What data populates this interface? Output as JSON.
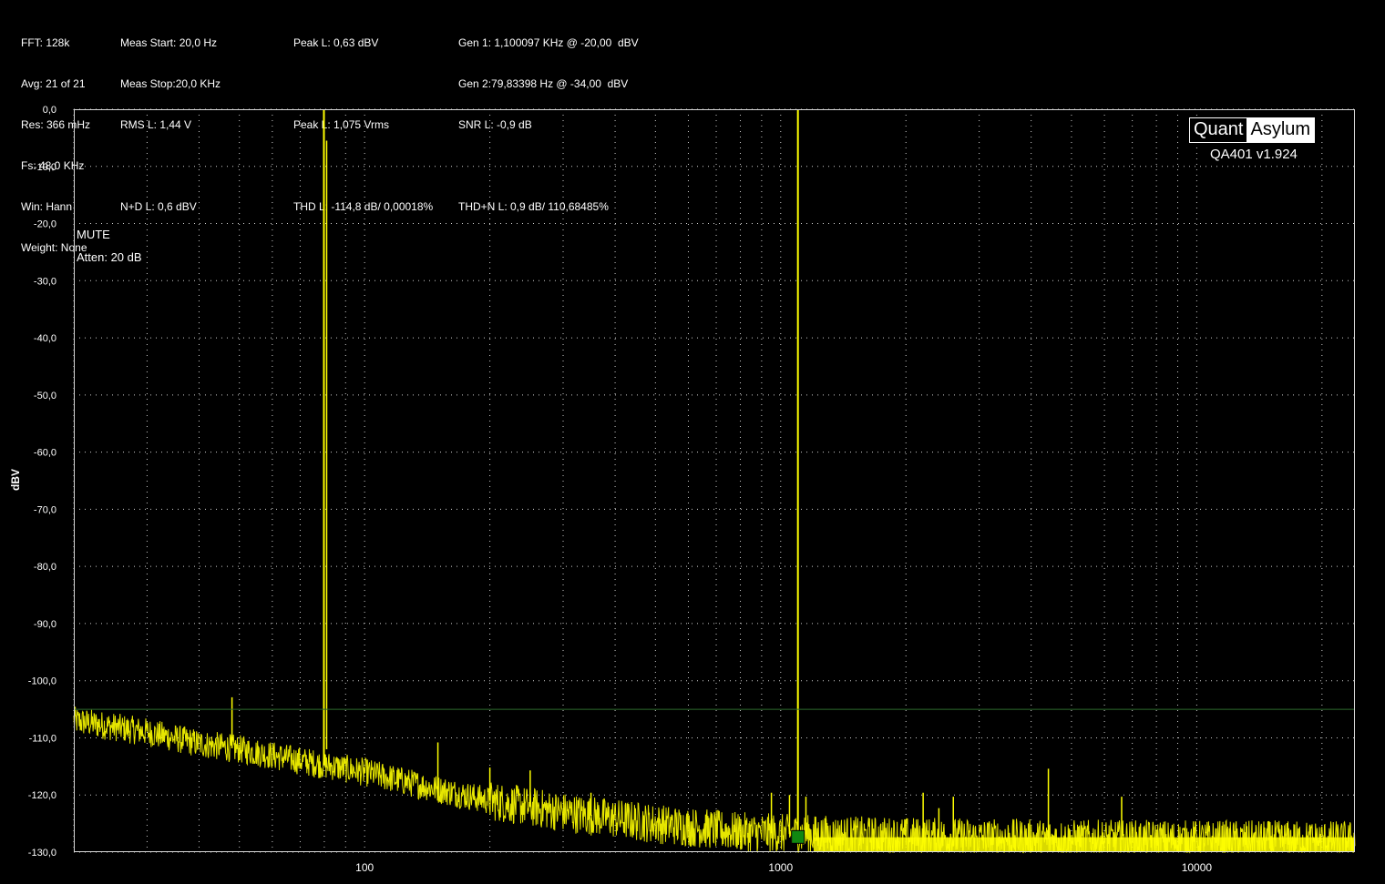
{
  "info": {
    "col1": [
      "FFT: 128k",
      "Avg: 21 of 21",
      "Res: 366 mHz",
      "Fs: 48,0 KHz",
      "Win: Hann",
      "Weight: None"
    ],
    "col2": [
      "Meas Start: 20,0 Hz",
      "Meas Stop:20,0 KHz",
      "RMS L: 1,44 V",
      "",
      "N+D L: 0,6 dBV"
    ],
    "col3": [
      "Peak L: 0,63 dBV",
      "",
      "Peak L: 1,075 Vrms",
      "",
      "THD L: -114,8 dB/ 0,00018%"
    ],
    "col4": [
      "Gen 1: 1,100097 KHz @ -20,00  dBV",
      "Gen 2:79,83398 Hz @ -34,00  dBV",
      "SNR L: -0,9 dB",
      "",
      "THD+N L: 0,9 dB/ 110,68485%"
    ]
  },
  "logo": {
    "left": "Quant",
    "right": "Asylum",
    "version": "QA401 v1.924"
  },
  "overlay": {
    "mute": "MUTE",
    "atten": "Atten: 20 dB"
  },
  "colors": {
    "trace": "#ffff00",
    "grid": "#cfcfcf",
    "marker": "#118811",
    "ref_line": "#2e6b2e"
  },
  "chart_data": {
    "type": "line",
    "xlabel": "",
    "ylabel": "dBV",
    "x_scale": "log",
    "xlim": [
      20,
      24000
    ],
    "ylim": [
      -130,
      0
    ],
    "x_ticks": [
      100,
      1000,
      10000
    ],
    "x_tick_labels": [
      "100",
      "1000",
      "10000"
    ],
    "y_ticks": [
      0,
      -10,
      -20,
      -30,
      -40,
      -50,
      -60,
      -70,
      -80,
      -90,
      -100,
      -110,
      -120,
      -130
    ],
    "y_tick_labels": [
      "0,0",
      "-10,0",
      "-20,0",
      "-30,0",
      "-40,0",
      "-50,0",
      "-60,0",
      "-70,0",
      "-80,0",
      "-90,0",
      "-100,0",
      "-110,0",
      "-120,0",
      "-130,0"
    ],
    "grid": true,
    "reference_line_dBV": -105,
    "marker_hz": 1100,
    "peaks": [
      {
        "hz": 79.83,
        "dbv": 0
      },
      {
        "hz": 1100.1,
        "dbv": 0
      },
      {
        "hz": 48,
        "dbv": -102.9
      },
      {
        "hz": 150,
        "dbv": -110.8
      },
      {
        "hz": 200,
        "dbv": -115.2
      },
      {
        "hz": 250,
        "dbv": -115.7
      },
      {
        "hz": 350,
        "dbv": -119.6
      },
      {
        "hz": 950,
        "dbv": -119.6
      },
      {
        "hz": 1050,
        "dbv": -120.0
      },
      {
        "hz": 1150,
        "dbv": -120.3
      },
      {
        "hz": 2200,
        "dbv": -119.6
      },
      {
        "hz": 2400,
        "dbv": -122.3
      },
      {
        "hz": 2600,
        "dbv": -120.3
      },
      {
        "hz": 4400,
        "dbv": -115.4
      },
      {
        "hz": 6600,
        "dbv": -120.3
      }
    ],
    "noise_floor": [
      {
        "hz": 20,
        "dbv": -107
      },
      {
        "hz": 30,
        "dbv": -109
      },
      {
        "hz": 40,
        "dbv": -111
      },
      {
        "hz": 50,
        "dbv": -112
      },
      {
        "hz": 70,
        "dbv": -114
      },
      {
        "hz": 100,
        "dbv": -116
      },
      {
        "hz": 150,
        "dbv": -119
      },
      {
        "hz": 200,
        "dbv": -121
      },
      {
        "hz": 300,
        "dbv": -123
      },
      {
        "hz": 500,
        "dbv": -125
      },
      {
        "hz": 800,
        "dbv": -126.5
      },
      {
        "hz": 1500,
        "dbv": -127.2
      },
      {
        "hz": 5000,
        "dbv": -127.8
      },
      {
        "hz": 24000,
        "dbv": -128.0
      }
    ]
  }
}
